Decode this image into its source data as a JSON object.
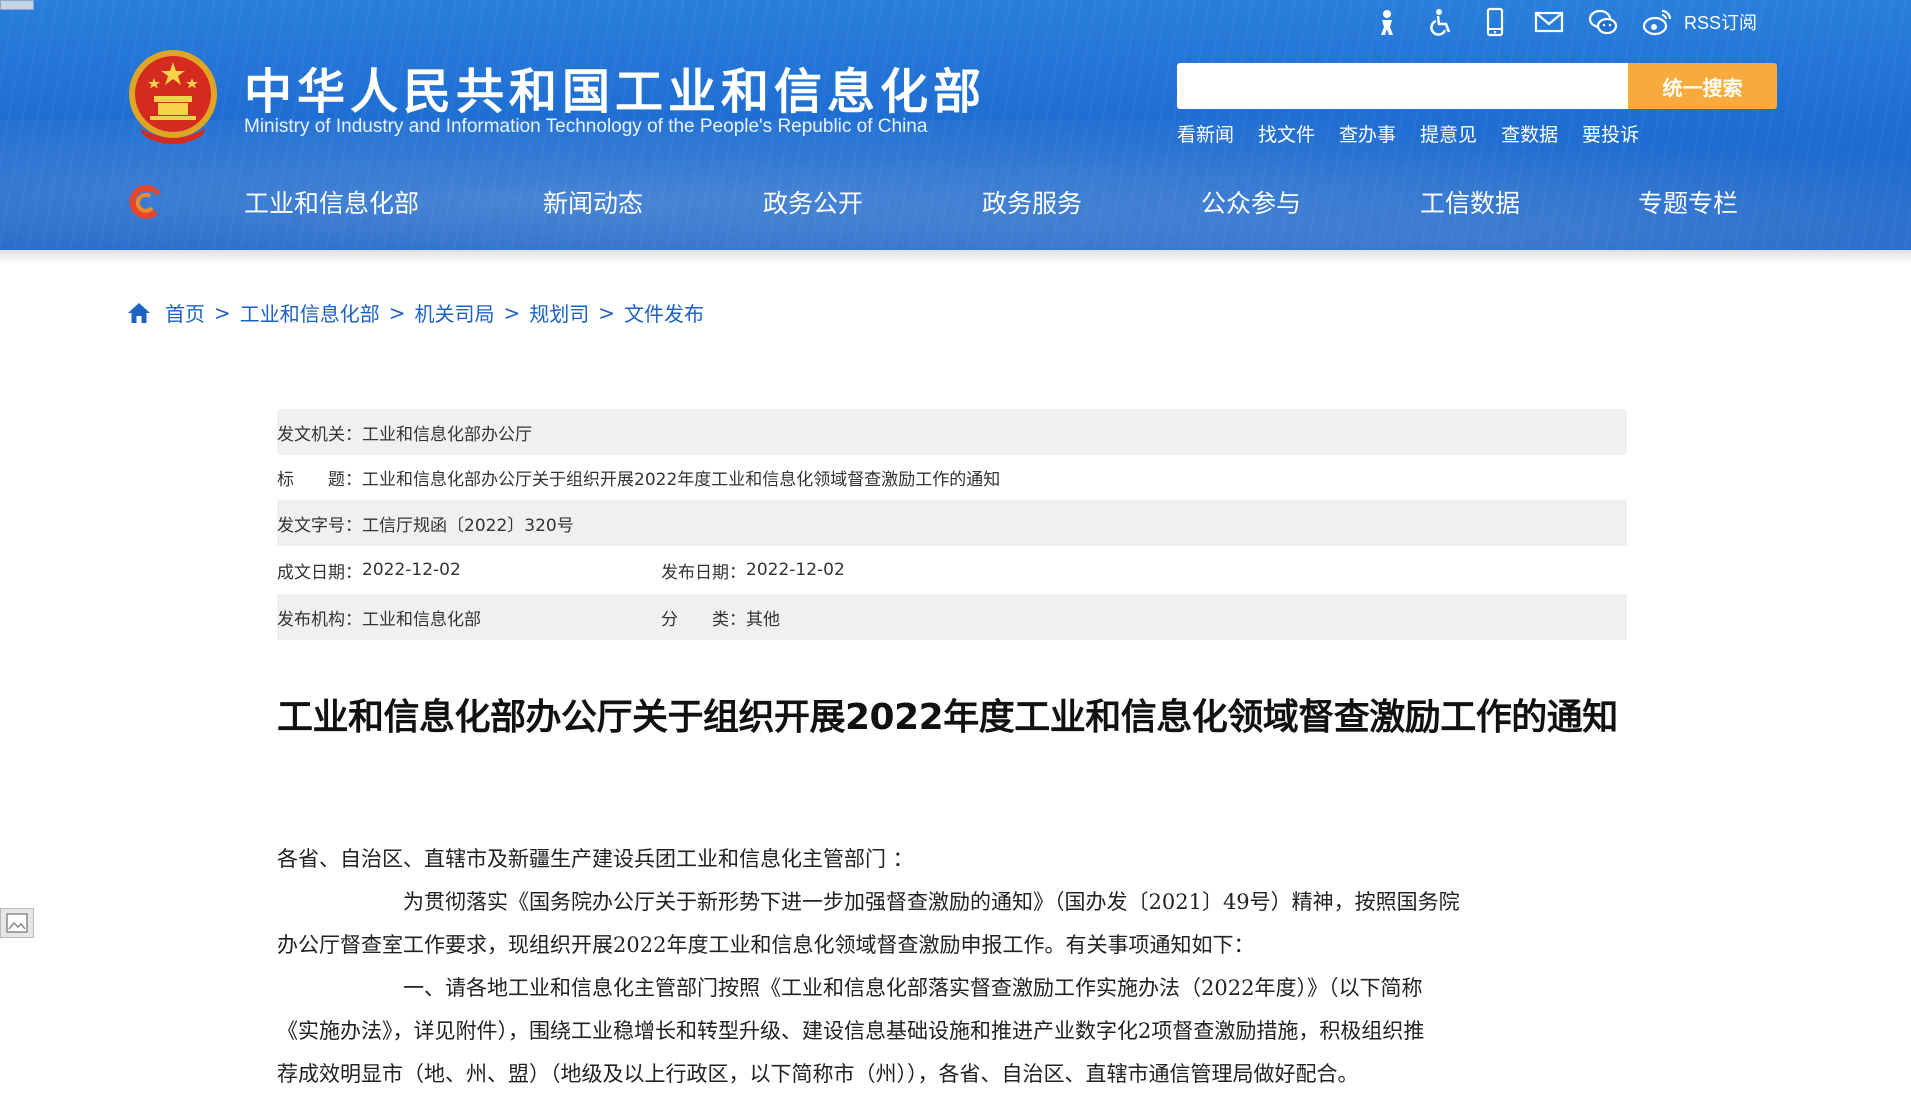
{
  "header": {
    "title_cn": "中华人民共和国工业和信息化部",
    "title_en": "Ministry of Industry and Information Technology of the People's Republic of China",
    "tools": [
      "accessibility-elder-icon",
      "wheelchair-icon",
      "mobile-phone-icon",
      "mail-icon",
      "wechat-icon",
      "weibo-icon"
    ],
    "rss_label": "RSS订阅",
    "search": {
      "placeholder": "",
      "button_label": "统一搜索"
    },
    "quick_links": [
      "看新闻",
      "找文件",
      "查办事",
      "提意见",
      "查数据",
      "要投诉"
    ],
    "colors": {
      "header_blue": "#1f6fd3",
      "search_button": "#f7ab3c",
      "link_blue": "#1d62c2"
    }
  },
  "nav": {
    "items": [
      "工业和信息化部",
      "新闻动态",
      "政务公开",
      "政务服务",
      "公众参与",
      "工信数据",
      "专题专栏"
    ]
  },
  "breadcrumb": {
    "items": [
      "首页",
      "工业和信息化部",
      "机关司局",
      "规划司",
      "文件发布"
    ],
    "separator": ">"
  },
  "meta": {
    "issuer_label": "发文机关：",
    "issuer": "工业和信息化部办公厅",
    "title_label": "标　　题：",
    "title": "工业和信息化部办公厅关于组织开展2022年度工业和信息化领域督查激励工作的通知",
    "doc_no_label": "发文字号：",
    "doc_no": "工信厅规函〔2022〕320号",
    "written_date_label": "成文日期：",
    "written_date": "2022-12-02",
    "publish_date_label": "发布日期：",
    "publish_date": "2022-12-02",
    "publisher_label": "发布机构：",
    "publisher": "工业和信息化部",
    "category_label": "分　　类：",
    "category": "其他"
  },
  "article": {
    "title": "工业和信息化部办公厅关于组织开展2022年度工业和信息化领域督查激励工作的通知",
    "lines": [
      "各省、自治区、直辖市及新疆生产建设兵团工业和信息化主管部门 ：",
      "　　　　　　为贯彻落实《国务院办公厅关于新形势下进一步加强督查激励的通知》（国办发〔2021〕49号）精神，按照国务院",
      "办公厅督查室工作要求，现组织开展2022年度工业和信息化领域督查激励申报工作。有关事项通知如下：",
      "　　　　　　一、请各地工业和信息化主管部门按照《工业和信息化部落实督查激励工作实施办法（2022年度）》（以下简称",
      "《实施办法》，详见附件），围绕工业稳增长和转型升级、建设信息基础设施和推进产业数字化2项督查激励措施，积极组织推",
      "荐成效明显市（地、州、盟）（地级及以上行政区，以下简称市（州）），各省、自治区、直辖市通信管理局做好配合。"
    ]
  }
}
